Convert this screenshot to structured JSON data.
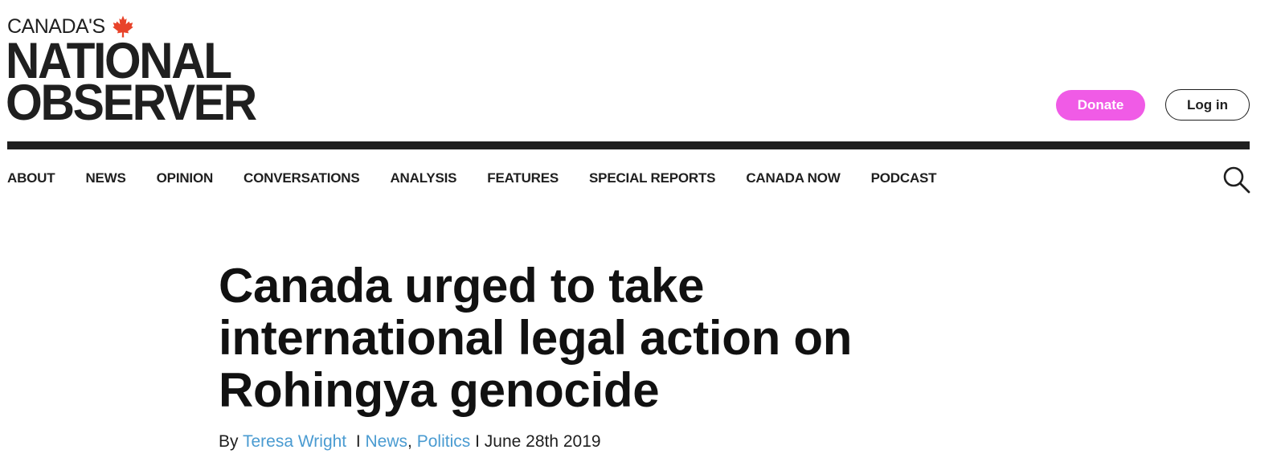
{
  "logo": {
    "line_top": "CANADA'S",
    "line_1": "NATIONAL",
    "line_2": "OBSERVER",
    "leaf_color": "#e8432a"
  },
  "header": {
    "donate_label": "Donate",
    "login_label": "Log in",
    "donate_color": "#f05be6"
  },
  "nav": {
    "items": [
      "ABOUT",
      "NEWS",
      "OPINION",
      "CONVERSATIONS",
      "ANALYSIS",
      "FEATURES",
      "SPECIAL REPORTS",
      "CANADA NOW",
      "PODCAST"
    ],
    "search_icon": "search-icon"
  },
  "article": {
    "title": "Canada urged to take international legal action on Rohingya genocide",
    "byline": {
      "prefix": "By",
      "author": "Teresa Wright",
      "separator": "I",
      "category_1": "News",
      "comma": ",",
      "category_2": "Politics",
      "date": "June 28th 2019"
    },
    "link_color": "#4a9bd1"
  }
}
